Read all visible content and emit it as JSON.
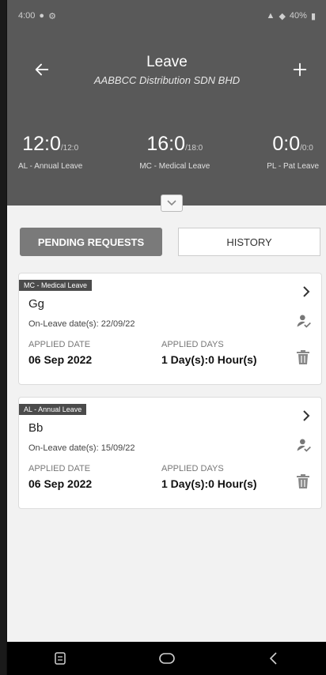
{
  "status": {
    "time": "4:00",
    "right_text": "40%"
  },
  "header": {
    "title": "Leave",
    "subtitle": "AABBCC Distribution SDN BHD"
  },
  "stats": [
    {
      "value": "12:0",
      "total": "/12:0",
      "label": "AL - Annual Leave"
    },
    {
      "value": "16:0",
      "total": "/18:0",
      "label": "MC - Medical Leave"
    },
    {
      "value": "0:0",
      "total": "/0:0",
      "label": "PL - Pat Leave"
    }
  ],
  "tabs": {
    "pending": "PENDING REQUESTS",
    "history": "HISTORY"
  },
  "requests": [
    {
      "tag": "MC - Medical Leave",
      "name": "Gg",
      "dates": "On-Leave date(s): 22/09/22",
      "applied_date_label": "APPLIED DATE",
      "applied_date": "06 Sep 2022",
      "applied_days_label": "APPLIED DAYS",
      "applied_days": "1 Day(s):0 Hour(s)"
    },
    {
      "tag": "AL - Annual Leave",
      "name": "Bb",
      "dates": "On-Leave date(s): 15/09/22",
      "applied_date_label": "APPLIED DATE",
      "applied_date": "06 Sep 2022",
      "applied_days_label": "APPLIED DAYS",
      "applied_days": "1 Day(s):0 Hour(s)"
    }
  ],
  "icons": {
    "back": "arrow-left-icon",
    "add": "plus-icon",
    "expand": "chevron-down-icon",
    "open": "chevron-right-icon",
    "approver": "user-check-icon",
    "delete": "trash-icon",
    "nav_recent": "recent-apps-icon",
    "nav_home": "home-icon",
    "nav_back": "back-icon"
  },
  "colors": {
    "header_bg": "#595959",
    "active_tab": "#7a7a7a",
    "tag_bg": "#4b4b4b"
  }
}
